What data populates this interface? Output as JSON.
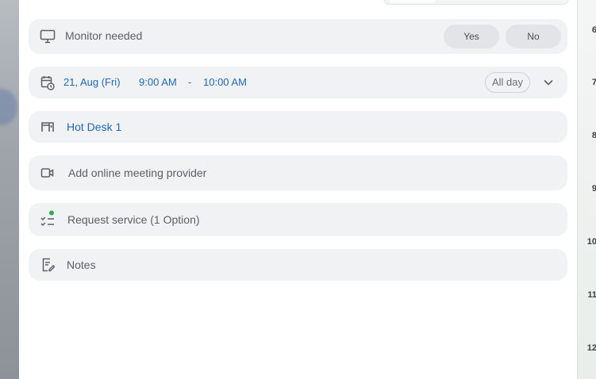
{
  "monitor": {
    "label": "Monitor needed",
    "yes": "Yes",
    "no": "No"
  },
  "schedule": {
    "date": "21, Aug (Fri)",
    "start": "9:00 AM",
    "separator": "-",
    "end": "10:00 AM",
    "all_day": "All day"
  },
  "resource": {
    "name": "Hot Desk 1"
  },
  "online_meeting": {
    "label": "Add online meeting provider"
  },
  "service": {
    "label": "Request service (1 Option)"
  },
  "notes": {
    "label": "Notes"
  },
  "calendar": {
    "hours": [
      "6",
      "7",
      "8",
      "9",
      "10",
      "11",
      "12"
    ]
  },
  "colors": {
    "accent": "#1f67b8",
    "row_bg": "#f1f2f4",
    "status_dot": "#2fa84f"
  }
}
